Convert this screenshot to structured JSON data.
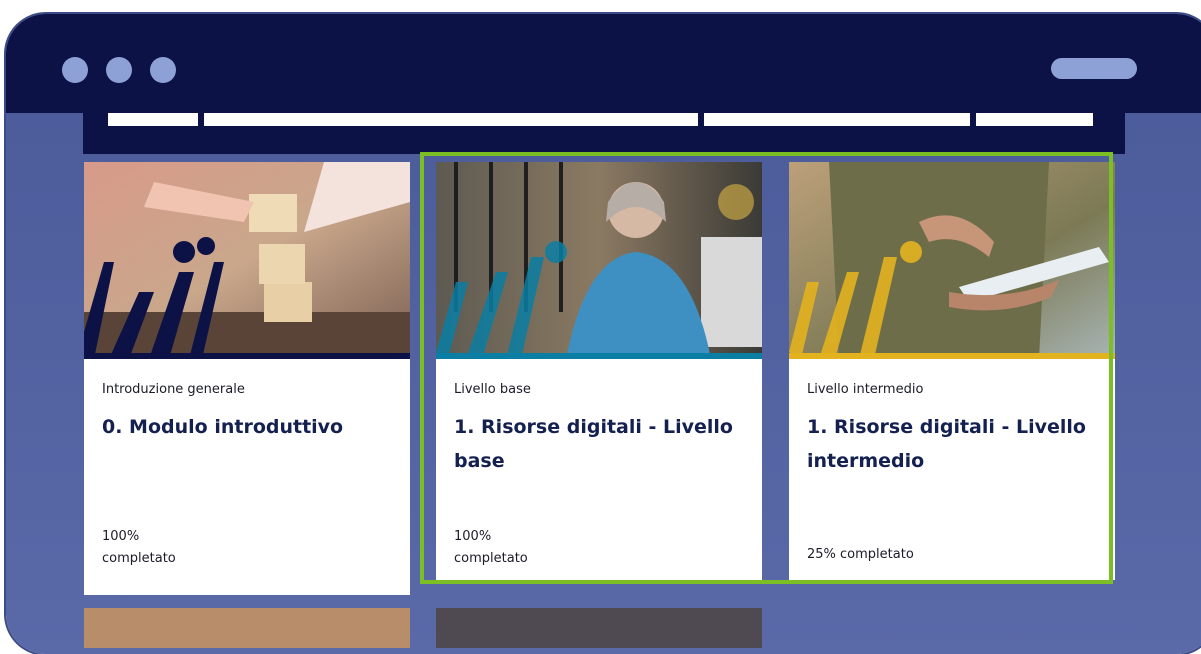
{
  "window": {
    "controls": [
      "close-dot",
      "minimize-dot",
      "maximize-dot"
    ]
  },
  "courses": [
    {
      "category": "Introduzione generale",
      "title": "0. Modulo introduttivo",
      "progress_percent": "100%",
      "progress_label": "completato",
      "progress_value": 100,
      "image": "hands-stacking-wooden-blocks",
      "accent": "#0c1245"
    },
    {
      "category": "Livello base",
      "title": "1. Risorse digitali - Livello base",
      "progress_percent": "100%",
      "progress_label": "completato",
      "progress_value": 100,
      "image": "smiling-woman-at-laptop",
      "accent": "#0a7ea3"
    },
    {
      "category": "Livello intermedio",
      "title": "1. Risorse digitali - Livello intermedio",
      "progress_text": "25% completato",
      "progress_value": 25,
      "image": "hands-using-tablet",
      "accent": "#e3b21f"
    }
  ],
  "colors": {
    "titlebar": "#0c1245",
    "background": "#4f5f9f",
    "highlight": "#7cbf25",
    "dots": "#8ea1d6"
  }
}
